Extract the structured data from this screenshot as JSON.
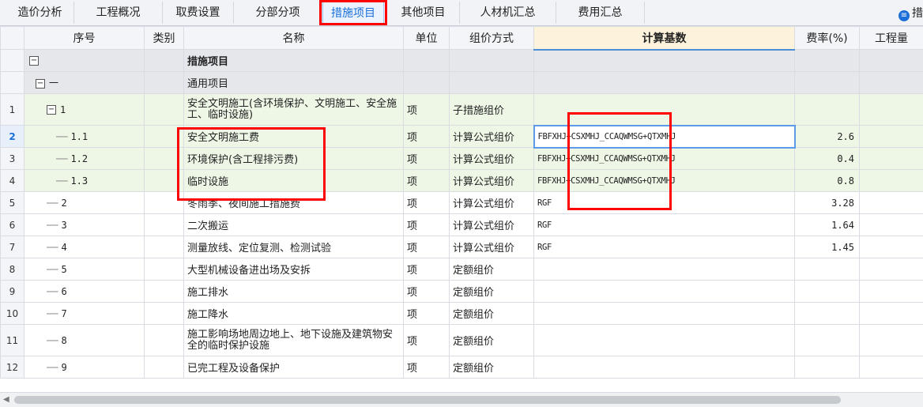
{
  "tabs": [
    {
      "label": "造价分析"
    },
    {
      "label": "工程概况"
    },
    {
      "label": "取费设置"
    },
    {
      "label": "分部分项"
    },
    {
      "label": "措施项目"
    },
    {
      "label": "其他项目"
    },
    {
      "label": "人材机汇总"
    },
    {
      "label": "费用汇总"
    }
  ],
  "tab_right": "措",
  "columns": {
    "seq": "序号",
    "type": "类别",
    "name": "名称",
    "unit": "单位",
    "method": "组价方式",
    "base": "计算基数",
    "rate": "费率(%)",
    "qty": "工程量"
  },
  "rows": [
    {
      "rn": "",
      "seq_box": "−",
      "seq": "",
      "name": "措施项目",
      "unit": "",
      "method": "",
      "base": "",
      "rate": ""
    },
    {
      "rn": "",
      "seq_box": "−",
      "seq": "一",
      "name": "通用项目",
      "unit": "",
      "method": "",
      "base": "",
      "rate": ""
    },
    {
      "rn": "1",
      "seq_box": "−",
      "seq": "1",
      "name": "安全文明施工(含环境保护、文明施工、安全施工、临时设施)",
      "unit": "项",
      "method": "子措施组价",
      "base": "",
      "rate": ""
    },
    {
      "rn": "2",
      "seq": "1.1",
      "name": "安全文明施工费",
      "unit": "项",
      "method": "计算公式组价",
      "base": "FBFXHJ+CSXMHJ_CCAQWMSG+QTXMHJ",
      "rate": "2.6"
    },
    {
      "rn": "3",
      "seq": "1.2",
      "name": "环境保护(含工程排污费)",
      "unit": "项",
      "method": "计算公式组价",
      "base": "FBFXHJ+CSXMHJ_CCAQWMSG+QTXMHJ",
      "rate": "0.4"
    },
    {
      "rn": "4",
      "seq": "1.3",
      "name": "临时设施",
      "unit": "项",
      "method": "计算公式组价",
      "base": "FBFXHJ+CSXMHJ_CCAQWMSG+QTXMHJ",
      "rate": "0.8"
    },
    {
      "rn": "5",
      "seq": "2",
      "name": "冬雨季、夜间施工措施费",
      "unit": "项",
      "method": "计算公式组价",
      "base": "RGF",
      "rate": "3.28"
    },
    {
      "rn": "6",
      "seq": "3",
      "name": "二次搬运",
      "unit": "项",
      "method": "计算公式组价",
      "base": "RGF",
      "rate": "1.64"
    },
    {
      "rn": "7",
      "seq": "4",
      "name": "测量放线、定位复测、检测试验",
      "unit": "项",
      "method": "计算公式组价",
      "base": "RGF",
      "rate": "1.45"
    },
    {
      "rn": "8",
      "seq": "5",
      "name": "大型机械设备进出场及安拆",
      "unit": "项",
      "method": "定额组价",
      "base": "",
      "rate": ""
    },
    {
      "rn": "9",
      "seq": "6",
      "name": "施工排水",
      "unit": "项",
      "method": "定额组价",
      "base": "",
      "rate": ""
    },
    {
      "rn": "10",
      "seq": "7",
      "name": "施工降水",
      "unit": "项",
      "method": "定额组价",
      "base": "",
      "rate": ""
    },
    {
      "rn": "11",
      "seq": "8",
      "name": "施工影响场地周边地上、地下设施及建筑物安全的临时保护设施",
      "unit": "项",
      "method": "定额组价",
      "base": "",
      "rate": ""
    },
    {
      "rn": "12",
      "seq": "9",
      "name": "已完工程及设备保护",
      "unit": "项",
      "method": "定额组价",
      "base": "",
      "rate": ""
    }
  ],
  "colors": {
    "accent": "#1b6fd6",
    "annotation": "#ff0000",
    "selected_border": "#5a9ae6"
  }
}
